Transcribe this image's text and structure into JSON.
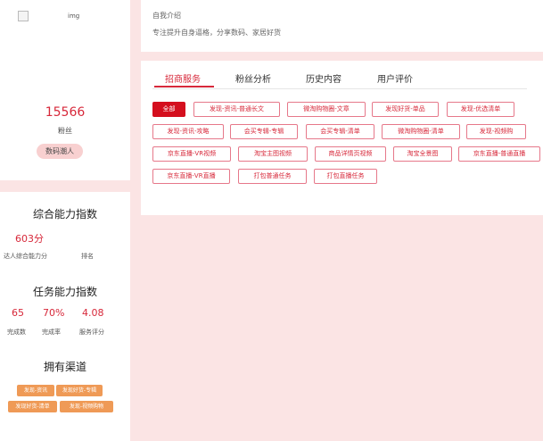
{
  "profile": {
    "avatar_alt": "img",
    "fans_count": "15566",
    "fans_label": "粉丝",
    "tag": "数码潮人"
  },
  "ability": {
    "title": "综合能力指数",
    "score": "603分",
    "score_label": "达人综合能力分",
    "rank_label": "排名"
  },
  "task": {
    "title": "任务能力指数",
    "completed": "65",
    "completed_label": "完成数",
    "rate": "70%",
    "rate_label": "完成率",
    "service": "4.08",
    "service_label": "服务评分"
  },
  "channels": {
    "title": "拥有渠道",
    "items": [
      "发现-资讯",
      "发现好货-专辑",
      "发现好货-清单",
      "发现-视频购物"
    ]
  },
  "intro": {
    "title": "自我介绍",
    "text": "专注提升自身逼格，分享数码、家居好货"
  },
  "tabs": [
    "招商服务",
    "粉丝分析",
    "历史内容",
    "用户评价"
  ],
  "filters": [
    "全部",
    "发现-资讯-普通长文",
    "微淘购物圈-文章",
    "发现好货-单品",
    "发现-优选清单",
    "发现-资讯-攻略",
    "会买专辑-专辑",
    "会买专辑-清单",
    "微淘购物圈-清单",
    "发现-视频购",
    "京东直播-VR视频",
    "淘宝主图视频",
    "商品详情页视频",
    "淘宝全景图",
    "京东直播-普通直播",
    "京东直播-VR直播",
    "打包普通任务",
    "打包直播任务"
  ],
  "colors": {
    "accent": "#d7283a",
    "background": "#fbe4e4",
    "chip": "#ef9a56"
  }
}
